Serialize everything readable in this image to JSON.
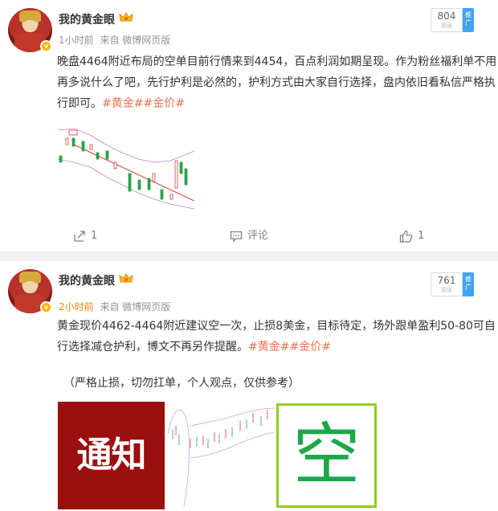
{
  "posts": [
    {
      "username": "我的黄金眼",
      "time": "1小时前",
      "source": "来自 微博网页版",
      "read_count": "804",
      "read_label": "阅读",
      "promote_label": "推广",
      "text": "晚盘4464附近布局的空单目前行情来到4454，百点利润如期呈现。作为粉丝福利单不用再多说什么了吧，先行护利是必然的，护利方式由大家自行选择，盘内依旧看私信严格执行即可。",
      "hashtags": "#黄金##金价#",
      "share_count": "1",
      "comment_label": "评论",
      "like_count": "1"
    },
    {
      "username": "我的黄金眼",
      "time": "2小时前",
      "source": "来自 微博网页版",
      "read_count": "761",
      "read_label": "阅读",
      "promote_label": "推广",
      "text": "黄金现价4462-4464附近建议空一次，止损8美金，目标待定，场外跟单盈利50-80可自行选择减仓护利，博文不再另作提醒。",
      "hashtags": "#黄金##金价#",
      "disclaimer": "（严格止损，切勿扛单，个人观点，仅供参考）",
      "image_text_1": "通知",
      "image_text_2": "空"
    }
  ],
  "colors": {
    "link": "#eb7350",
    "time_highlight": "#ff8200",
    "separator": "#f1f2f5",
    "promote": "#3fa3f4"
  },
  "icons": [
    "crown-icon",
    "verified-icon",
    "share-icon",
    "comment-icon",
    "like-icon"
  ]
}
